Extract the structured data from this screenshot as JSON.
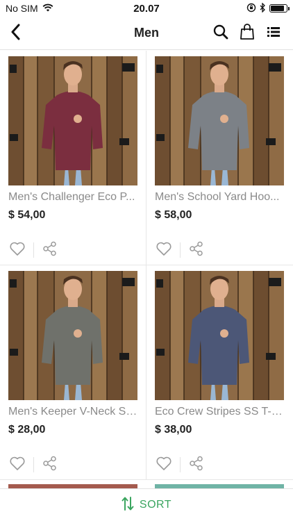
{
  "status_bar": {
    "carrier": "No SIM",
    "time": "20.07",
    "icons": [
      "wifi-icon",
      "rotation-lock-icon",
      "bluetooth-icon",
      "battery-icon"
    ],
    "battery_level": 0.85
  },
  "nav": {
    "title": "Men",
    "back_icon": "chevron-left-icon",
    "actions": [
      "search-icon",
      "shopping-bag-icon",
      "list-view-icon"
    ]
  },
  "products": [
    {
      "name": "Men's Challenger Eco P...",
      "price": "$ 54,00",
      "image": "photo-maroon-hoodie",
      "shirt_color": "#7b2e3f"
    },
    {
      "name": "Men's School Yard Hoo...",
      "price": "$ 58,00",
      "image": "photo-grey-hoodie",
      "shirt_color": "#7c8187"
    },
    {
      "name": "Men's Keeper V-Neck SS...",
      "price": "$ 28,00",
      "image": "photo-grey-tee",
      "shirt_color": "#6f716b"
    },
    {
      "name": "Eco Crew Stripes SS T-S...",
      "price": "$ 38,00",
      "image": "photo-navy-tee",
      "shirt_color": "#4c5777"
    }
  ],
  "card_actions": [
    "heart-icon",
    "share-icon"
  ],
  "sort": {
    "label": "SORT",
    "icon": "sort-arrows-icon"
  },
  "colors": {
    "accent_green": "#3aa55f",
    "icon_grey": "#9a9a9a",
    "wood_dark": "#5b3f26",
    "wood_light": "#a07a52"
  }
}
